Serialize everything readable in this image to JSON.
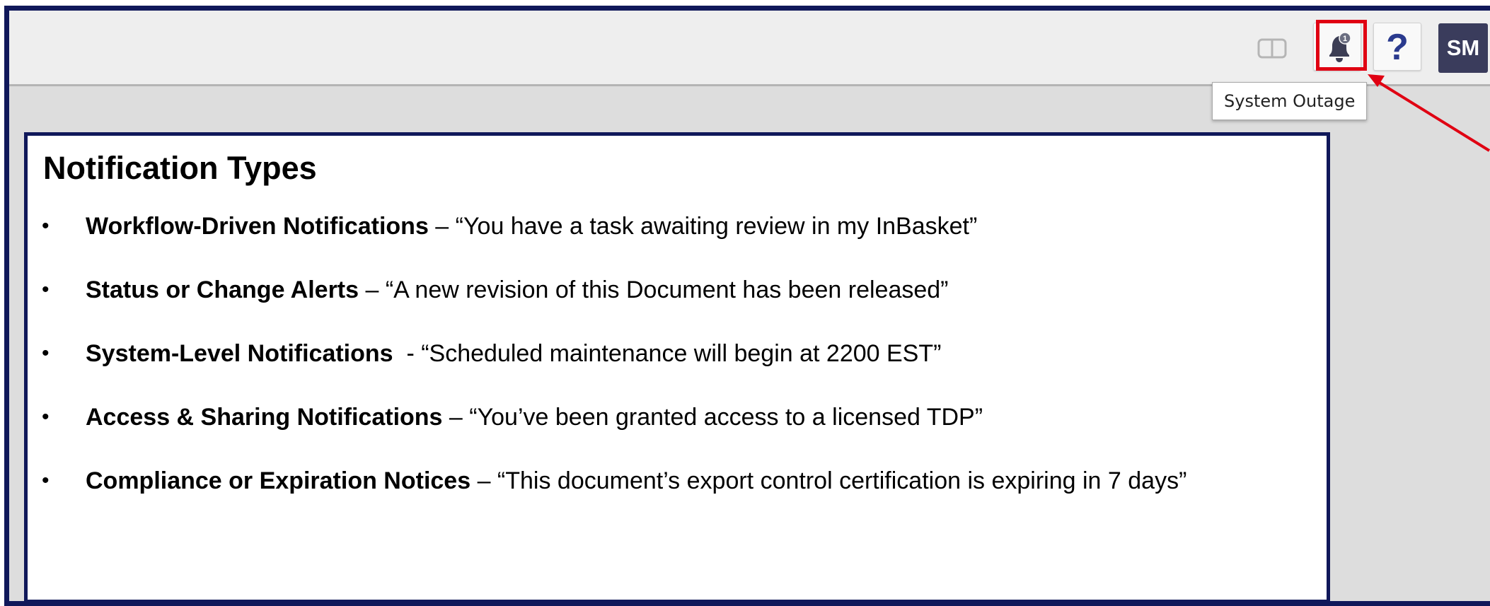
{
  "topbar": {
    "icons": {
      "layout": "split-view-icon",
      "notifications": "bell-icon",
      "help": "question-mark-icon"
    },
    "notification_count": "1",
    "help_label": "?",
    "avatar_initials": "SM",
    "tooltip": "System Outage"
  },
  "colors": {
    "frame_border": "#10185a",
    "highlight": "#e00012",
    "avatar_bg": "#3a3c5c",
    "accent": "#2a3a8e"
  },
  "content": {
    "title": "Notification Types",
    "bullet": "•",
    "items": [
      {
        "label": "Workflow-Driven Notifications",
        "text": " – “You have a task awaiting review in my InBasket”"
      },
      {
        "label": "Status or Change Alerts",
        "text": " – “A new revision of this Document has been released”"
      },
      {
        "label": "System-Level Notifications",
        "text": "  - “Scheduled maintenance will begin at 2200 EST”"
      },
      {
        "label": "Access & Sharing Notifications",
        "text": " – “You’ve been granted access to a licensed TDP”"
      },
      {
        "label": "Compliance or Expiration Notices",
        "text": " – “This document’s export control certification is expiring in 7 days”"
      }
    ]
  }
}
